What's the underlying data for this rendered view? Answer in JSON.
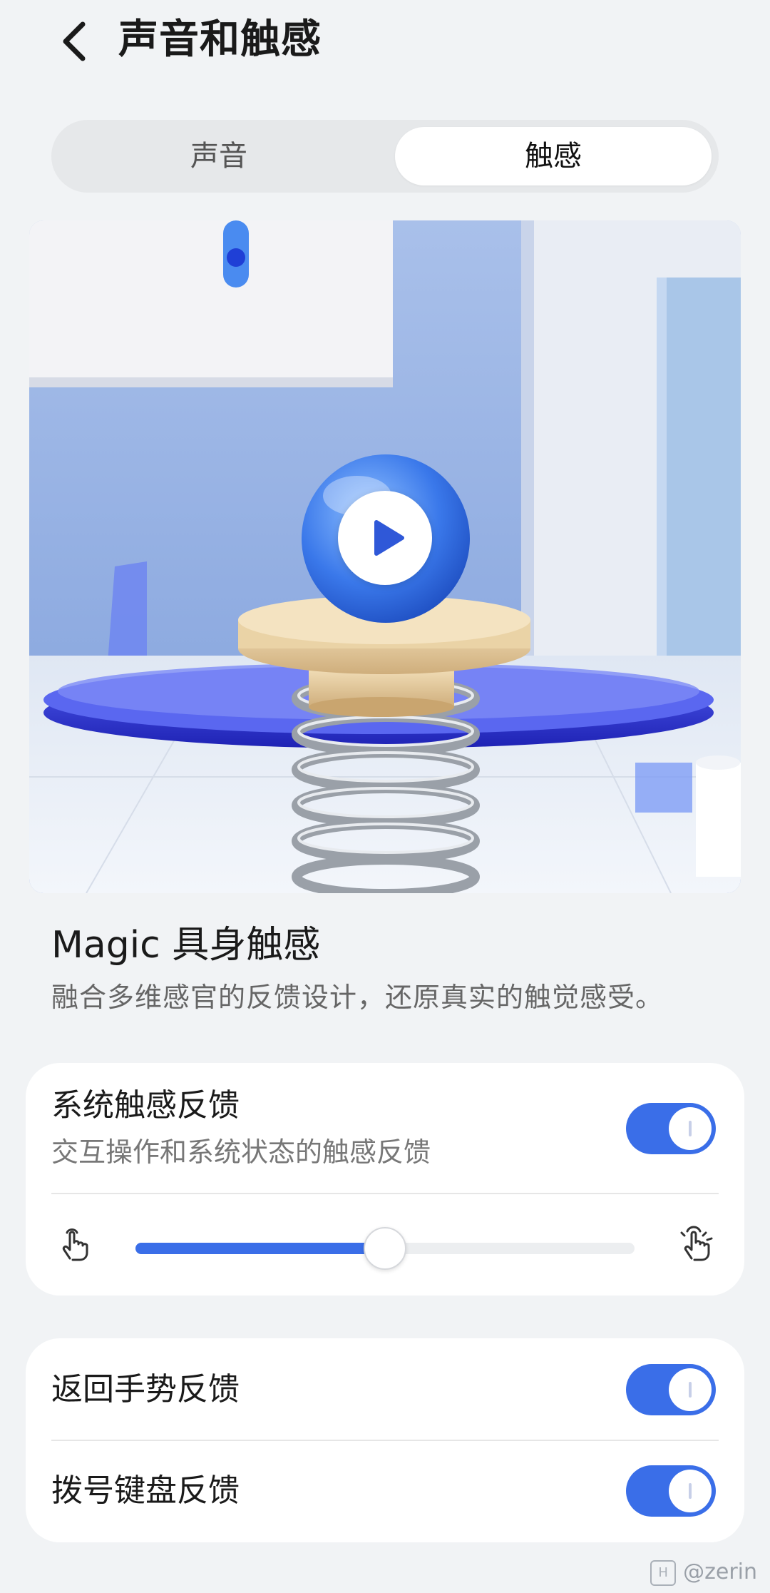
{
  "header": {
    "title": "声音和触感",
    "back_icon": "chevron-left-icon"
  },
  "tabs": {
    "items": [
      {
        "label": "声音",
        "selected": false
      },
      {
        "label": "触感",
        "selected": true
      }
    ]
  },
  "media": {
    "play_icon": "play-icon"
  },
  "feature": {
    "title": "Magic 具身触感",
    "description": "融合多维感官的反馈设计，还原真实的触觉感受。"
  },
  "system_haptics": {
    "title": "系统触感反馈",
    "subtitle": "交互操作和系统状态的触感反馈",
    "enabled": true,
    "intensity_fraction": 0.5,
    "min_icon": "hand-tap-light-icon",
    "max_icon": "hand-tap-strong-icon"
  },
  "settings": [
    {
      "label": "返回手势反馈",
      "enabled": true
    },
    {
      "label": "拨号键盘反馈",
      "enabled": true
    }
  ],
  "watermark": {
    "text": "@zerin"
  },
  "colors": {
    "accent": "#3a6ee8",
    "background": "#f1f3f5"
  }
}
